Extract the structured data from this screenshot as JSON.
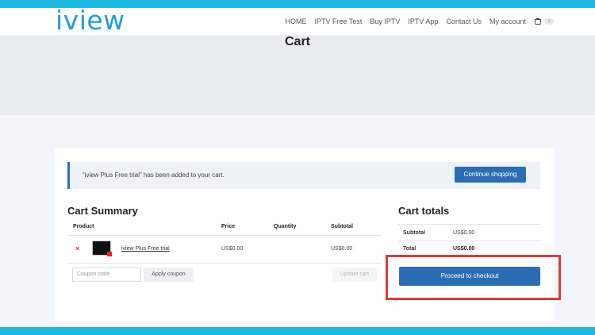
{
  "brand": {
    "logo_text": "iview"
  },
  "nav": {
    "items": [
      "HOME",
      "IPTV Free Test",
      "Buy IPTV",
      "IPTV App",
      "Contact Us",
      "My account"
    ],
    "cart_count": "1"
  },
  "page": {
    "title": "Cart"
  },
  "notice": {
    "message": "“iview Plus Free trial” has been added to your cart.",
    "button": "Continue shopping"
  },
  "cart_summary": {
    "title": "Cart Summary",
    "headers": [
      "Product",
      "Price",
      "Quantity",
      "Subtotal"
    ],
    "items": [
      {
        "name": "iview Plus Free trial",
        "price": "US$0.00",
        "subtotal": "US$0.00",
        "remove": "×"
      }
    ],
    "coupon_placeholder": "Coupon code",
    "apply_coupon": "Apply coupon",
    "update_cart": "Update cart"
  },
  "cart_totals": {
    "title": "Cart totals",
    "subtotal_label": "Subtotal",
    "subtotal_value": "US$0.00",
    "total_label": "Total",
    "total_value": "US$0.00",
    "checkout_button": "Proceed to checkout"
  },
  "colors": {
    "accent": "#1fb8e0",
    "button": "#2b6db3",
    "highlight": "#e03a3a"
  }
}
